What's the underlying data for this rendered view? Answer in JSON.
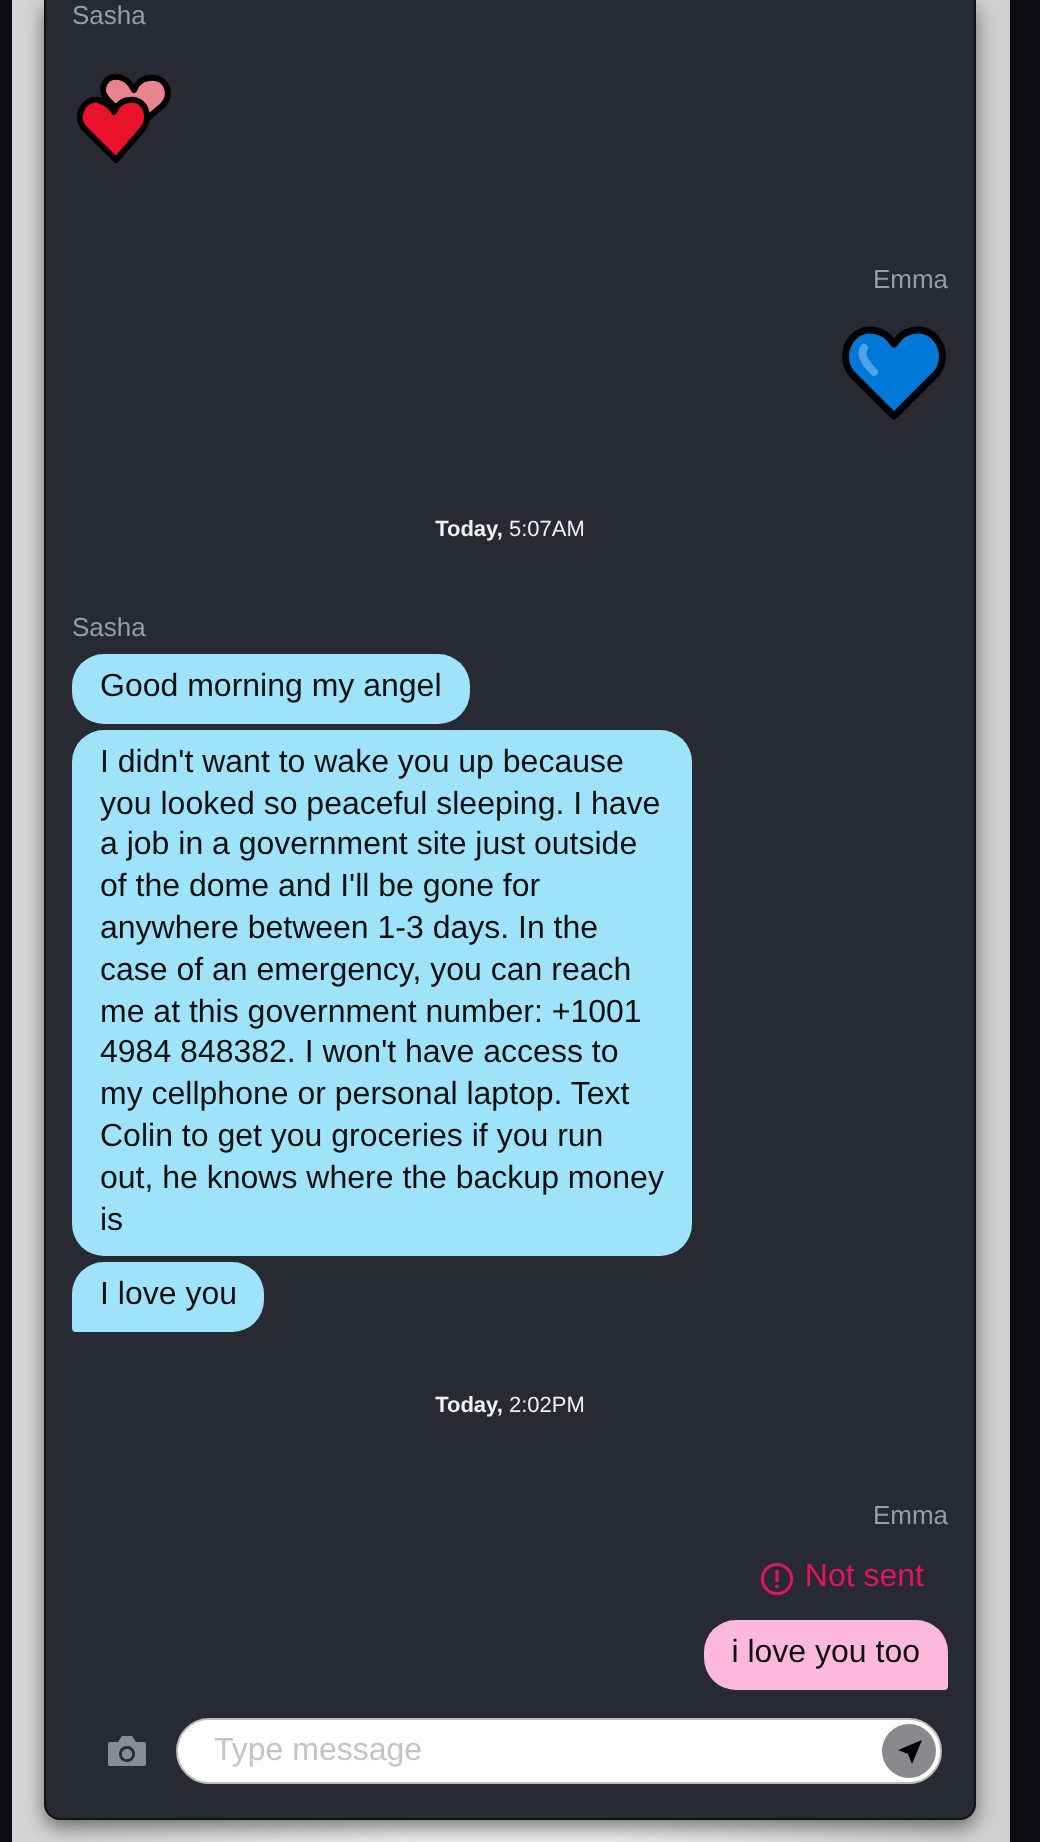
{
  "feed": [
    {
      "kind": "sender",
      "outgoing": false,
      "text": "Sasha"
    },
    {
      "kind": "hearts",
      "outgoing": false
    },
    {
      "kind": "sender",
      "outgoing": true,
      "text": "Emma"
    },
    {
      "kind": "heart",
      "outgoing": true
    },
    {
      "kind": "timestamp",
      "text": "**Today,** 5:07AM"
    },
    {
      "kind": "sender",
      "outgoing": false,
      "text": "Sasha"
    },
    {
      "kind": "bubble",
      "outgoing": false,
      "tail": false,
      "text": "Good morning my angel"
    },
    {
      "kind": "bubble",
      "outgoing": false,
      "tail": false,
      "text": "I didn't want to wake you up because you looked so peaceful sleeping. I have a job in a government site just outside of the dome and I'll be gone for anywhere between 1-3 days. In the case of an emergency, you can reach me at this government number: +1001 4984 848382. I won't have access to my cellphone or personal laptop. Text Colin to get you groceries if you run out, he knows where the backup money is"
    },
    {
      "kind": "bubble",
      "outgoing": false,
      "tail": true,
      "text": "I love you"
    },
    {
      "kind": "timestamp",
      "text": "**Today,** 2:02PM"
    },
    {
      "kind": "sender",
      "outgoing": true,
      "text": "Emma"
    },
    {
      "kind": "status",
      "outgoing": true,
      "text": "Not sent"
    },
    {
      "kind": "bubble",
      "outgoing": true,
      "tail": true,
      "text": "i love you too"
    }
  ],
  "composer": {
    "placeholder": "Type message"
  }
}
